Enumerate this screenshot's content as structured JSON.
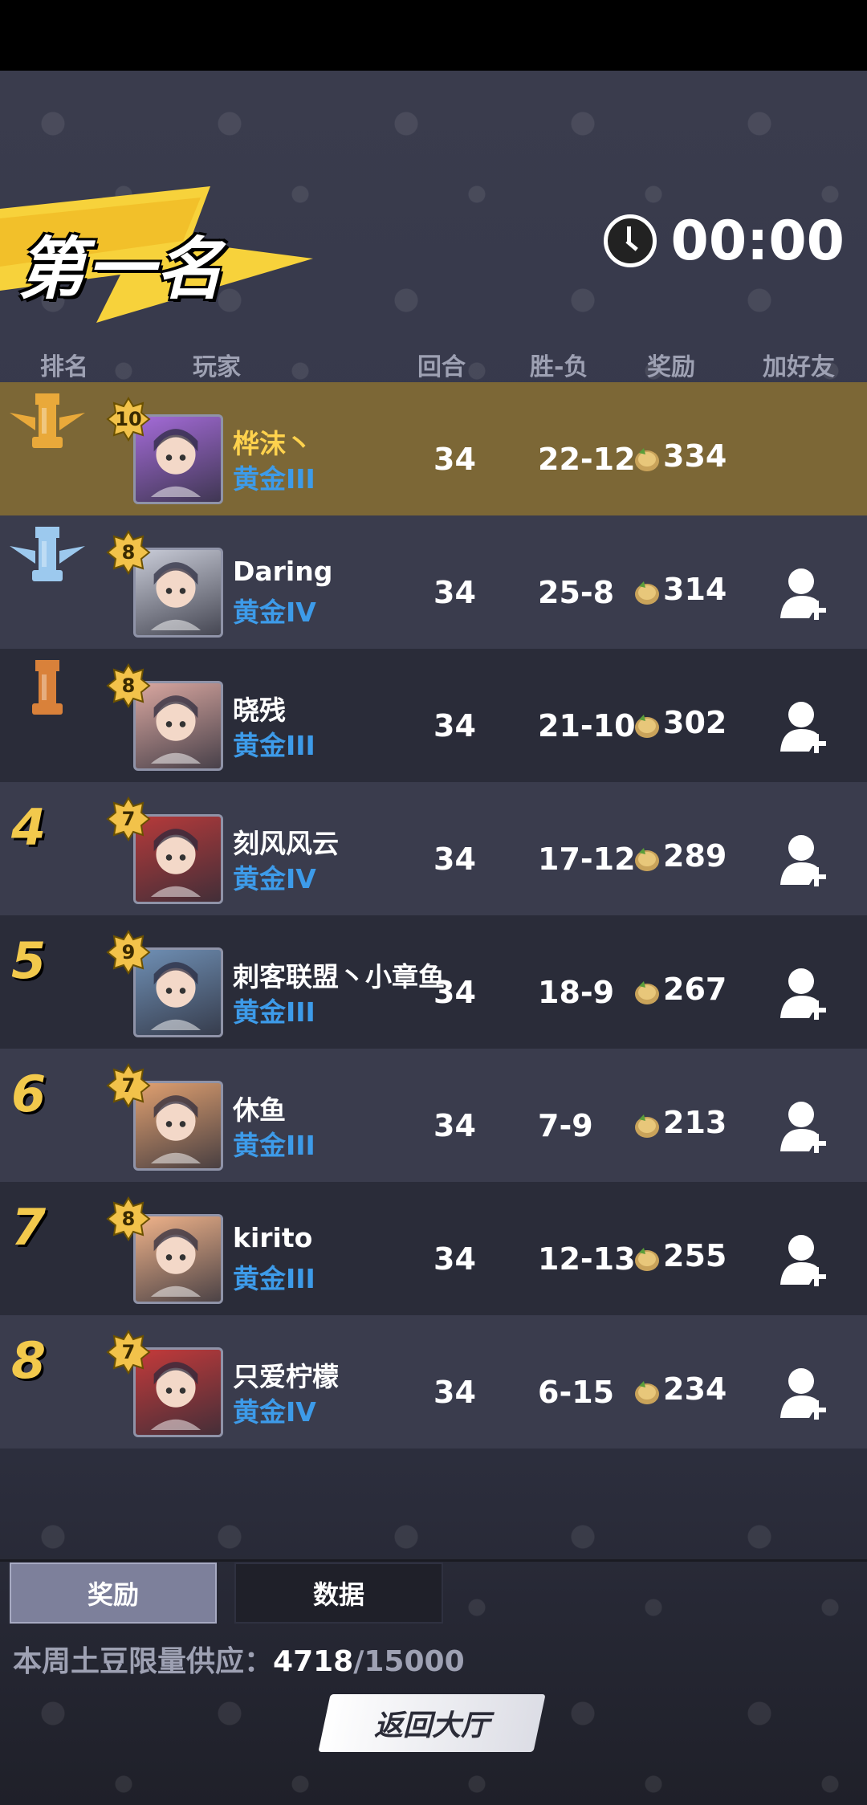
{
  "banner": {
    "title": "第一名"
  },
  "timer": {
    "value": "00:00",
    "icon": "clock-icon"
  },
  "headers": {
    "rank": "排名",
    "player": "玩家",
    "rounds": "回合",
    "winloss": "胜-负",
    "reward": "奖励",
    "add_friend": "加好友"
  },
  "rows": [
    {
      "rank": "1",
      "level": "10",
      "name": "桦沫丶",
      "tier": "黄金III",
      "rounds": "34",
      "wl": "22-12",
      "reward": "334",
      "add_friend": false
    },
    {
      "rank": "2",
      "level": "8",
      "name": "Daring",
      "tier": "黄金IV",
      "rounds": "34",
      "wl": "25-8",
      "reward": "314",
      "add_friend": true
    },
    {
      "rank": "3",
      "level": "8",
      "name": "晓残",
      "tier": "黄金III",
      "rounds": "34",
      "wl": "21-10",
      "reward": "302",
      "add_friend": true
    },
    {
      "rank": "4",
      "level": "7",
      "name": "刻风风云",
      "tier": "黄金IV",
      "rounds": "34",
      "wl": "17-12",
      "reward": "289",
      "add_friend": true
    },
    {
      "rank": "5",
      "level": "9",
      "name": "刺客联盟丶小章鱼",
      "tier": "黄金III",
      "rounds": "34",
      "wl": "18-9",
      "reward": "267",
      "add_friend": true
    },
    {
      "rank": "6",
      "level": "7",
      "name": "休鱼",
      "tier": "黄金III",
      "rounds": "34",
      "wl": "7-9",
      "reward": "213",
      "add_friend": true
    },
    {
      "rank": "7",
      "level": "8",
      "name": "kirito",
      "tier": "黄金III",
      "rounds": "34",
      "wl": "12-13",
      "reward": "255",
      "add_friend": true
    },
    {
      "rank": "8",
      "level": "7",
      "name": "只爱柠檬",
      "tier": "黄金IV",
      "rounds": "34",
      "wl": "6-15",
      "reward": "234",
      "add_friend": true
    }
  ],
  "tabs": {
    "reward": "奖励",
    "data": "数据"
  },
  "supply": {
    "label": "本周土豆限量供应：",
    "current": "4718",
    "limit": "/15000"
  },
  "back_button": "返回大厅",
  "colors": {
    "gold": "#ffd24d",
    "tier_blue": "#3d9be9",
    "first_row": "#7c6736"
  }
}
